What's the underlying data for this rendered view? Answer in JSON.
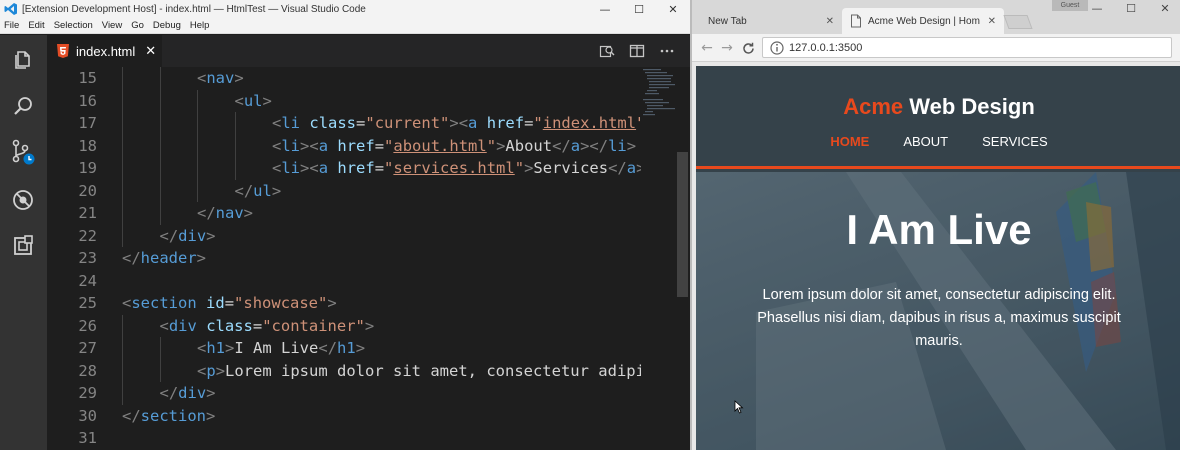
{
  "vscode": {
    "window_title": "[Extension Development Host] - index.html — HtmlTest — Visual Studio Code",
    "menu": [
      "File",
      "Edit",
      "Selection",
      "View",
      "Go",
      "Debug",
      "Help"
    ],
    "tab": {
      "label": "index.html",
      "close": "✕"
    },
    "lines": [
      {
        "n": "15",
        "i": 2,
        "t": [
          [
            "pu",
            "<"
          ],
          [
            "tg",
            "nav"
          ],
          [
            "pu",
            ">"
          ]
        ]
      },
      {
        "n": "16",
        "i": 3,
        "t": [
          [
            "pu",
            "<"
          ],
          [
            "tg",
            "ul"
          ],
          [
            "pu",
            ">"
          ]
        ]
      },
      {
        "n": "17",
        "i": 4,
        "t": [
          [
            "pu",
            "<"
          ],
          [
            "tg",
            "li"
          ],
          [
            "tx",
            " "
          ],
          [
            "at",
            "class"
          ],
          [
            "tx",
            "="
          ],
          [
            "st",
            "\"current\""
          ],
          [
            "pu",
            "><"
          ],
          [
            "tg",
            "a"
          ],
          [
            "tx",
            " "
          ],
          [
            "at",
            "href"
          ],
          [
            "tx",
            "="
          ],
          [
            "st",
            "\""
          ],
          [
            "stu",
            "index.html"
          ],
          [
            "st",
            "\""
          ],
          [
            "pu",
            ">"
          ]
        ]
      },
      {
        "n": "18",
        "i": 4,
        "t": [
          [
            "pu",
            "<"
          ],
          [
            "tg",
            "li"
          ],
          [
            "pu",
            "><"
          ],
          [
            "tg",
            "a"
          ],
          [
            "tx",
            " "
          ],
          [
            "at",
            "href"
          ],
          [
            "tx",
            "="
          ],
          [
            "st",
            "\""
          ],
          [
            "stu",
            "about.html"
          ],
          [
            "st",
            "\""
          ],
          [
            "pu",
            ">"
          ],
          [
            "tx",
            "About"
          ],
          [
            "pu",
            "</"
          ],
          [
            "tg",
            "a"
          ],
          [
            "pu",
            "></"
          ],
          [
            "tg",
            "li"
          ],
          [
            "pu",
            ">"
          ]
        ]
      },
      {
        "n": "19",
        "i": 4,
        "t": [
          [
            "pu",
            "<"
          ],
          [
            "tg",
            "li"
          ],
          [
            "pu",
            "><"
          ],
          [
            "tg",
            "a"
          ],
          [
            "tx",
            " "
          ],
          [
            "at",
            "href"
          ],
          [
            "tx",
            "="
          ],
          [
            "st",
            "\""
          ],
          [
            "stu",
            "services.html"
          ],
          [
            "st",
            "\""
          ],
          [
            "pu",
            ">"
          ],
          [
            "tx",
            "Services"
          ],
          [
            "pu",
            "</"
          ],
          [
            "tg",
            "a"
          ],
          [
            "pu",
            ">"
          ]
        ]
      },
      {
        "n": "20",
        "i": 3,
        "t": [
          [
            "pu",
            "</"
          ],
          [
            "tg",
            "ul"
          ],
          [
            "pu",
            ">"
          ]
        ]
      },
      {
        "n": "21",
        "i": 2,
        "t": [
          [
            "pu",
            "</"
          ],
          [
            "tg",
            "nav"
          ],
          [
            "pu",
            ">"
          ]
        ]
      },
      {
        "n": "22",
        "i": 1,
        "t": [
          [
            "pu",
            "</"
          ],
          [
            "tg",
            "div"
          ],
          [
            "pu",
            ">"
          ]
        ]
      },
      {
        "n": "23",
        "i": 0,
        "t": [
          [
            "pu",
            "</"
          ],
          [
            "tg",
            "header"
          ],
          [
            "pu",
            ">"
          ]
        ]
      },
      {
        "n": "24",
        "i": 0,
        "t": []
      },
      {
        "n": "25",
        "i": 0,
        "t": [
          [
            "pu",
            "<"
          ],
          [
            "tg",
            "section"
          ],
          [
            "tx",
            " "
          ],
          [
            "at",
            "id"
          ],
          [
            "tx",
            "="
          ],
          [
            "st",
            "\"showcase\""
          ],
          [
            "pu",
            ">"
          ]
        ]
      },
      {
        "n": "26",
        "i": 1,
        "t": [
          [
            "pu",
            "<"
          ],
          [
            "tg",
            "div"
          ],
          [
            "tx",
            " "
          ],
          [
            "at",
            "class"
          ],
          [
            "tx",
            "="
          ],
          [
            "st",
            "\"container\""
          ],
          [
            "pu",
            ">"
          ]
        ]
      },
      {
        "n": "27",
        "i": 2,
        "t": [
          [
            "pu",
            "<"
          ],
          [
            "tg",
            "h1"
          ],
          [
            "pu",
            ">"
          ],
          [
            "tx",
            "I Am Live"
          ],
          [
            "pu",
            "</"
          ],
          [
            "tg",
            "h1"
          ],
          [
            "pu",
            ">"
          ]
        ]
      },
      {
        "n": "28",
        "i": 2,
        "t": [
          [
            "pu",
            "<"
          ],
          [
            "tg",
            "p"
          ],
          [
            "pu",
            ">"
          ],
          [
            "tx",
            "Lorem ipsum dolor sit amet, consectetur adipis"
          ]
        ]
      },
      {
        "n": "29",
        "i": 1,
        "t": [
          [
            "pu",
            "</"
          ],
          [
            "tg",
            "div"
          ],
          [
            "pu",
            ">"
          ]
        ]
      },
      {
        "n": "30",
        "i": 0,
        "t": [
          [
            "pu",
            "</"
          ],
          [
            "tg",
            "section"
          ],
          [
            "pu",
            ">"
          ]
        ]
      },
      {
        "n": "31",
        "i": 0,
        "t": []
      }
    ]
  },
  "chrome": {
    "tabs": [
      {
        "label": "New Tab",
        "close": "✕"
      },
      {
        "label": "Acme Web Design | Hom",
        "close": "✕"
      }
    ],
    "guest": "Guest",
    "url": "127.0.0.1:3500"
  },
  "site": {
    "brand_highlight": "Acme",
    "brand_rest": " Web Design",
    "nav": [
      "HOME",
      "ABOUT",
      "SERVICES"
    ],
    "heading": "I Am Live",
    "paragraph": "Lorem ipsum dolor sit amet, consectetur adipiscing elit. Phasellus nisi diam, dapibus in risus a, maximus suscipit mauris."
  },
  "colors": {
    "accent": "#e8491d",
    "header_bg": "#35424a",
    "editor_bg": "#1e1e1e"
  }
}
